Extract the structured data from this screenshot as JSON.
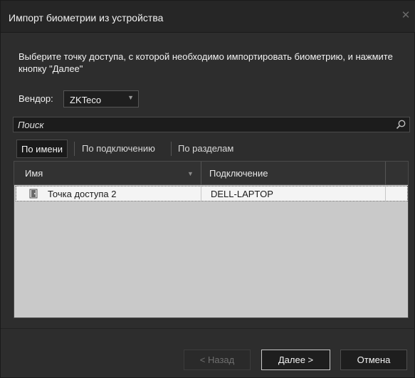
{
  "window": {
    "title": "Импорт биометрии из устройства"
  },
  "instructions": "Выберите точку доступа, с которой необходимо импортировать биометрию, и нажмите кнопку \"Далее\"",
  "vendor": {
    "label": "Вендор:",
    "value": "ZKTeco"
  },
  "search": {
    "placeholder": "Поиск"
  },
  "tabs": [
    {
      "label": "По имени",
      "active": true
    },
    {
      "label": "По подключению",
      "active": false
    },
    {
      "label": "По разделам",
      "active": false
    }
  ],
  "table": {
    "columns": [
      "Имя",
      "Подключение"
    ],
    "rows": [
      {
        "name": "Точка доступа 2",
        "connection": "DELL-LAPTOP"
      }
    ]
  },
  "buttons": {
    "back": "< Назад",
    "next": "Далее >",
    "cancel": "Отмена"
  }
}
